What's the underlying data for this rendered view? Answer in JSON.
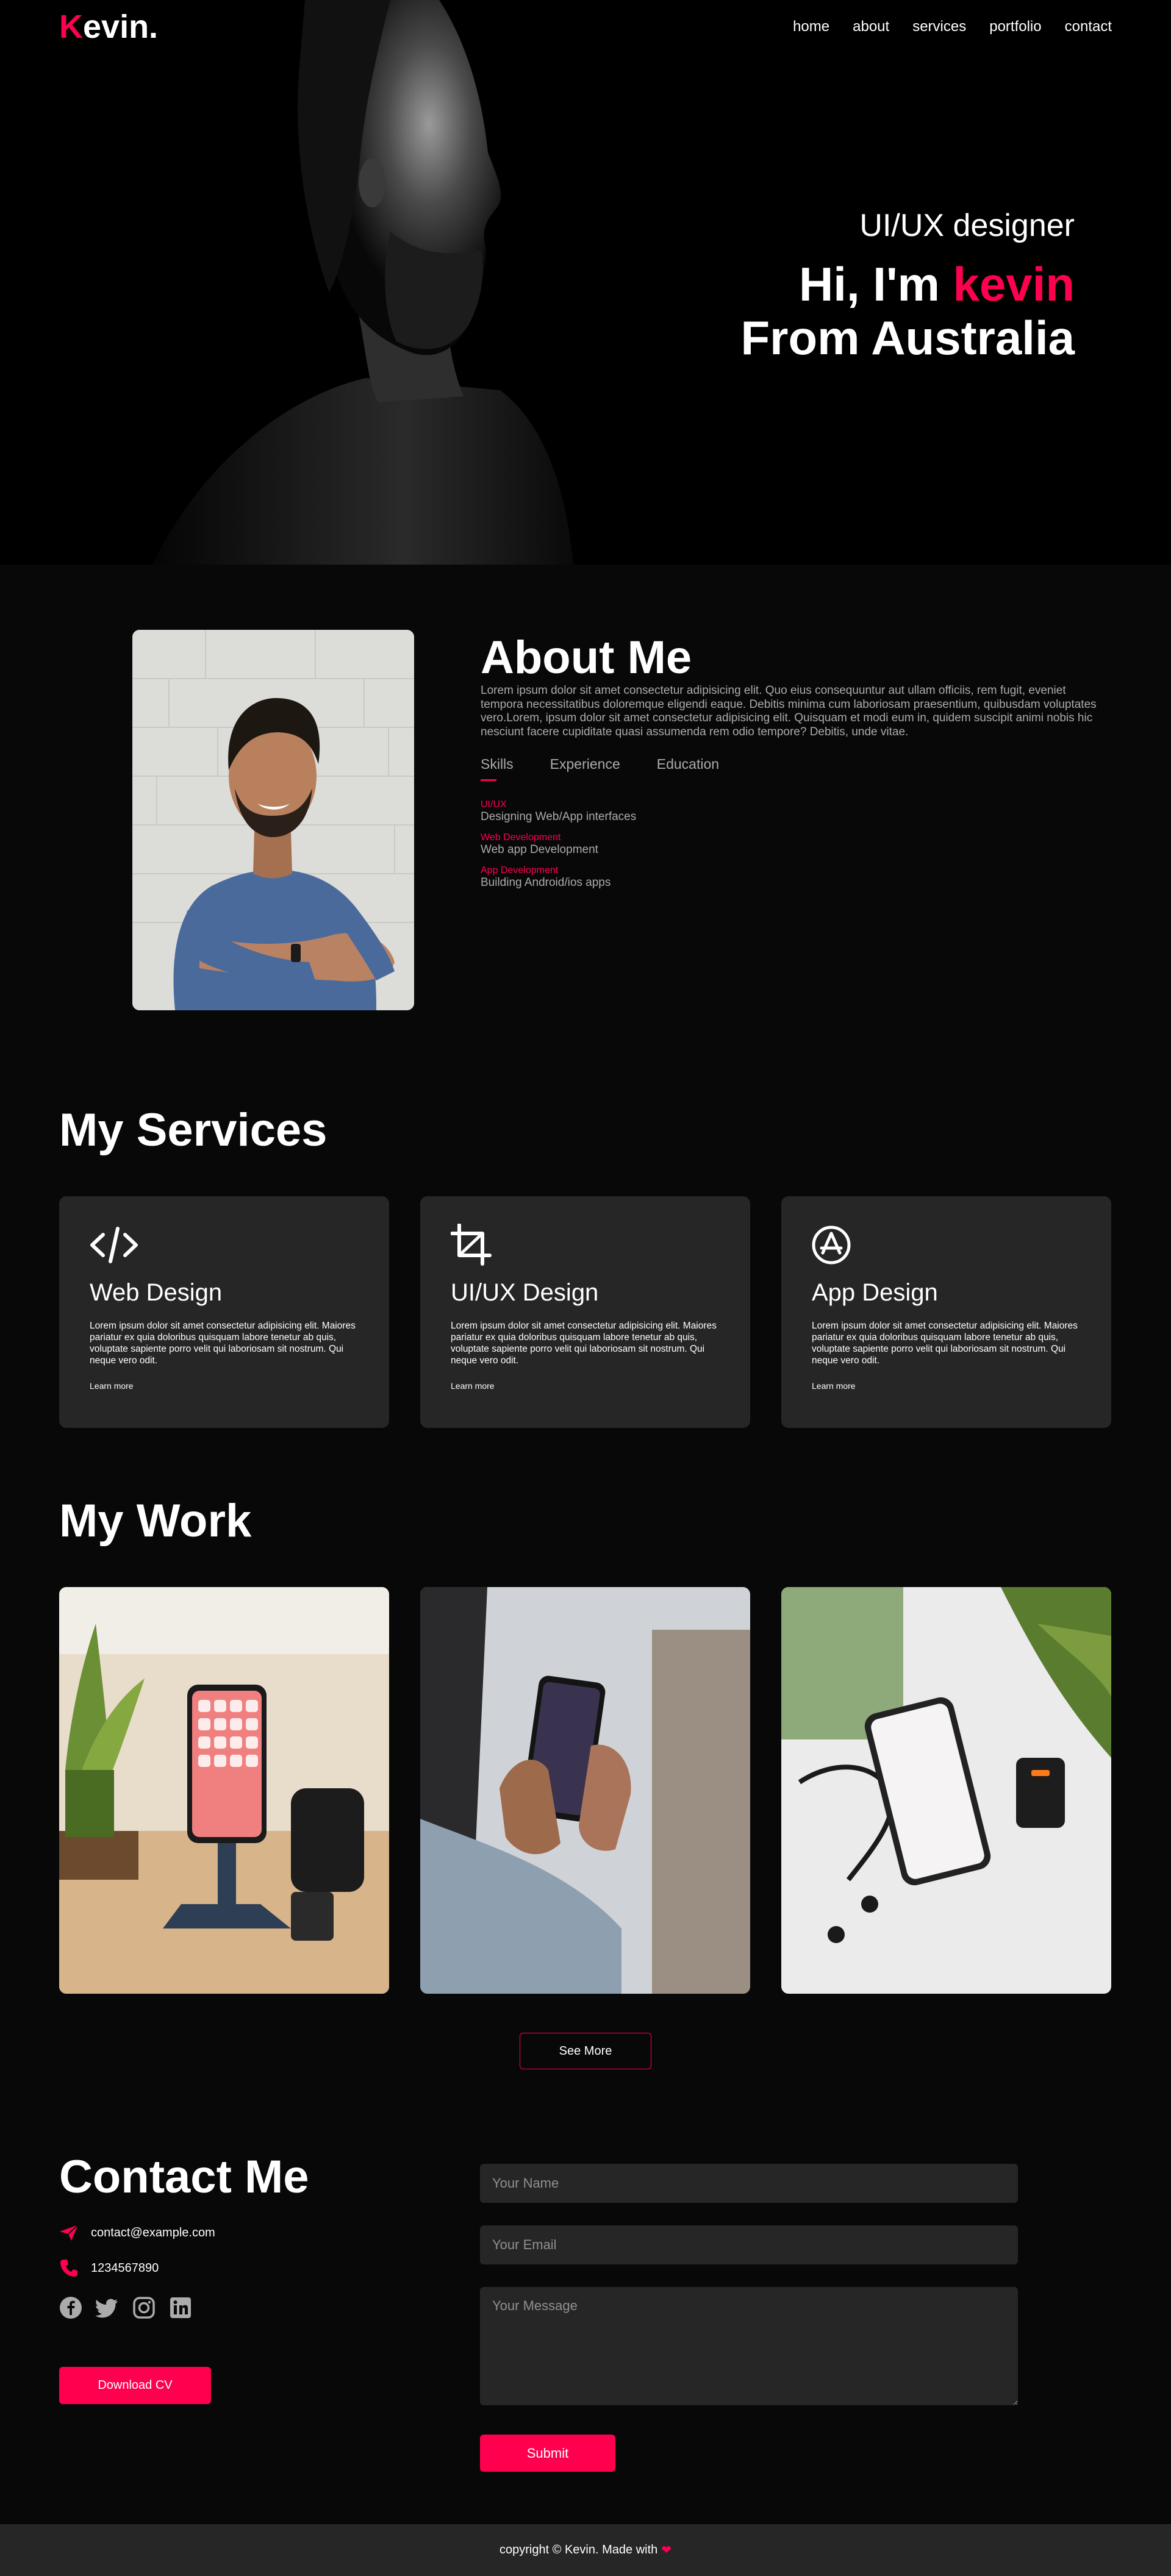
{
  "nav": {
    "logo_first": "K",
    "logo_rest": "evin.",
    "links": [
      "home",
      "about",
      "services",
      "portfolio",
      "contact"
    ]
  },
  "hero": {
    "role": "UI/UX designer",
    "greeting": "Hi, I'm ",
    "name": "kevin",
    "from": "From Australia"
  },
  "about": {
    "title": "About Me",
    "description": "Lorem ipsum dolor sit amet consectetur adipisicing elit. Quo eius consequuntur aut ullam officiis, rem fugit, eveniet tempora necessitatibus doloremque eligendi eaque. Debitis minima cum laboriosam praesentium, quibusdam voluptates vero.Lorem, ipsum dolor sit amet consectetur adipisicing elit. Quisquam et modi eum in, quidem suscipit animi nobis hic nesciunt facere cupiditate quasi assumenda rem odio tempore? Debitis, unde vitae.",
    "tabs": [
      "Skills",
      "Experience",
      "Education"
    ],
    "active_tab": "Skills",
    "skills": [
      {
        "title": "UI/UX",
        "detail": "Designing Web/App interfaces"
      },
      {
        "title": "Web Development",
        "detail": "Web app Development"
      },
      {
        "title": "App Development",
        "detail": "Building Android/ios apps"
      }
    ]
  },
  "services": {
    "title": "My Services",
    "items": [
      {
        "icon": "code-icon",
        "title": "Web Design",
        "description": "Lorem ipsum dolor sit amet consectetur adipisicing elit. Maiores pariatur ex quia doloribus quisquam labore tenetur ab quis, voluptate sapiente porro velit qui laboriosam sit nostrum. Qui neque vero odit.",
        "link": "Learn more"
      },
      {
        "icon": "crop-icon",
        "title": "UI/UX Design",
        "description": "Lorem ipsum dolor sit amet consectetur adipisicing elit. Maiores pariatur ex quia doloribus quisquam labore tenetur ab quis, voluptate sapiente porro velit qui laboriosam sit nostrum. Qui neque vero odit.",
        "link": "Learn more"
      },
      {
        "icon": "app-store-icon",
        "title": "App Design",
        "description": "Lorem ipsum dolor sit amet consectetur adipisicing elit. Maiores pariatur ex quia doloribus quisquam labore tenetur ab quis, voluptate sapiente porro velit qui laboriosam sit nostrum. Qui neque vero odit.",
        "link": "Learn more"
      }
    ]
  },
  "work": {
    "title": "My Work",
    "see_more": "See More"
  },
  "contact": {
    "title": "Contact Me",
    "email": "contact@example.com",
    "phone": "1234567890",
    "social_icons": [
      "facebook-icon",
      "twitter-icon",
      "instagram-icon",
      "linkedin-icon"
    ],
    "download_cv": "Download CV",
    "form": {
      "name_placeholder": "Your Name",
      "email_placeholder": "Your Email",
      "message_placeholder": "Your Message",
      "submit": "Submit"
    }
  },
  "footer": {
    "copyright": "copyright © Kevin. Made with"
  },
  "colors": {
    "accent": "#ff004f",
    "background": "#080808",
    "card": "#262626",
    "muted_text": "#ababab"
  }
}
